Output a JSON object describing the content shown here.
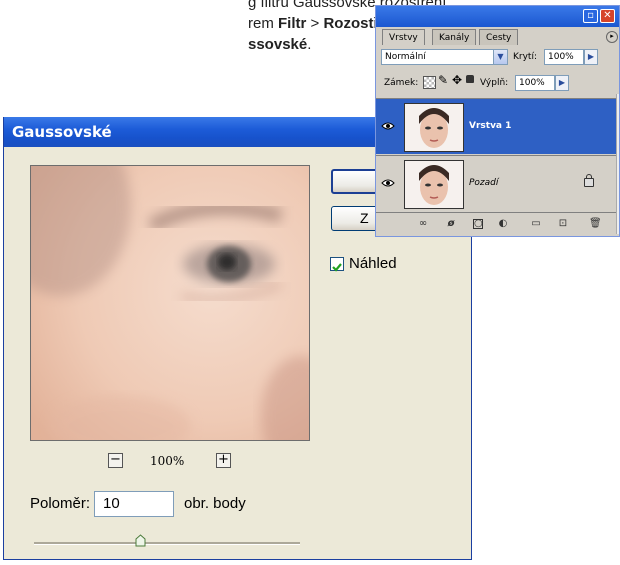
{
  "tutorial": {
    "line1": "g filtru Gaussovské rozostření",
    "line2_prefix": "rem ",
    "line2_b1": "Filtr",
    "line2_sep": " > ",
    "line2_b2": "Rozostření",
    "line2_suffix": " >",
    "line3_b": "ssovské",
    "line3_suffix": "."
  },
  "dialog": {
    "title": "Gaussovské",
    "ok_label": "",
    "reset_label": "Z",
    "preview_label": "Náhled",
    "preview_checked": true,
    "zoom_level": "100%",
    "zoom_out_icon": "minus-icon",
    "zoom_in_icon": "plus-icon",
    "radius_label": "Poloměr:",
    "radius_value": "10",
    "radius_unit": "obr. body",
    "radius_slider_fraction": 0.4
  },
  "layers_panel": {
    "tabs": [
      "Vrstvy",
      "Kanály",
      "Cesty"
    ],
    "blend_mode": "Normální",
    "opacity_label": "Krytí:",
    "opacity_value": "100%",
    "lock_label": "Zámek:",
    "fill_label": "Výplň:",
    "fill_value": "100%",
    "layers": [
      {
        "name": "Vrstva 1",
        "selected": true,
        "visible": true,
        "locked": false
      },
      {
        "name": "Pozadí",
        "selected": false,
        "visible": true,
        "locked": true
      }
    ],
    "footer_icons": [
      "link-icon",
      "layer-style-icon",
      "mask-icon",
      "adjustment-icon",
      "folder-icon",
      "new-layer-icon",
      "trash-icon"
    ]
  },
  "colors": {
    "title_bar": "#1d5cd8",
    "dialog_bg": "#ece9d8",
    "selected_layer": "#2e60c4",
    "check_mark": "#21a121"
  }
}
